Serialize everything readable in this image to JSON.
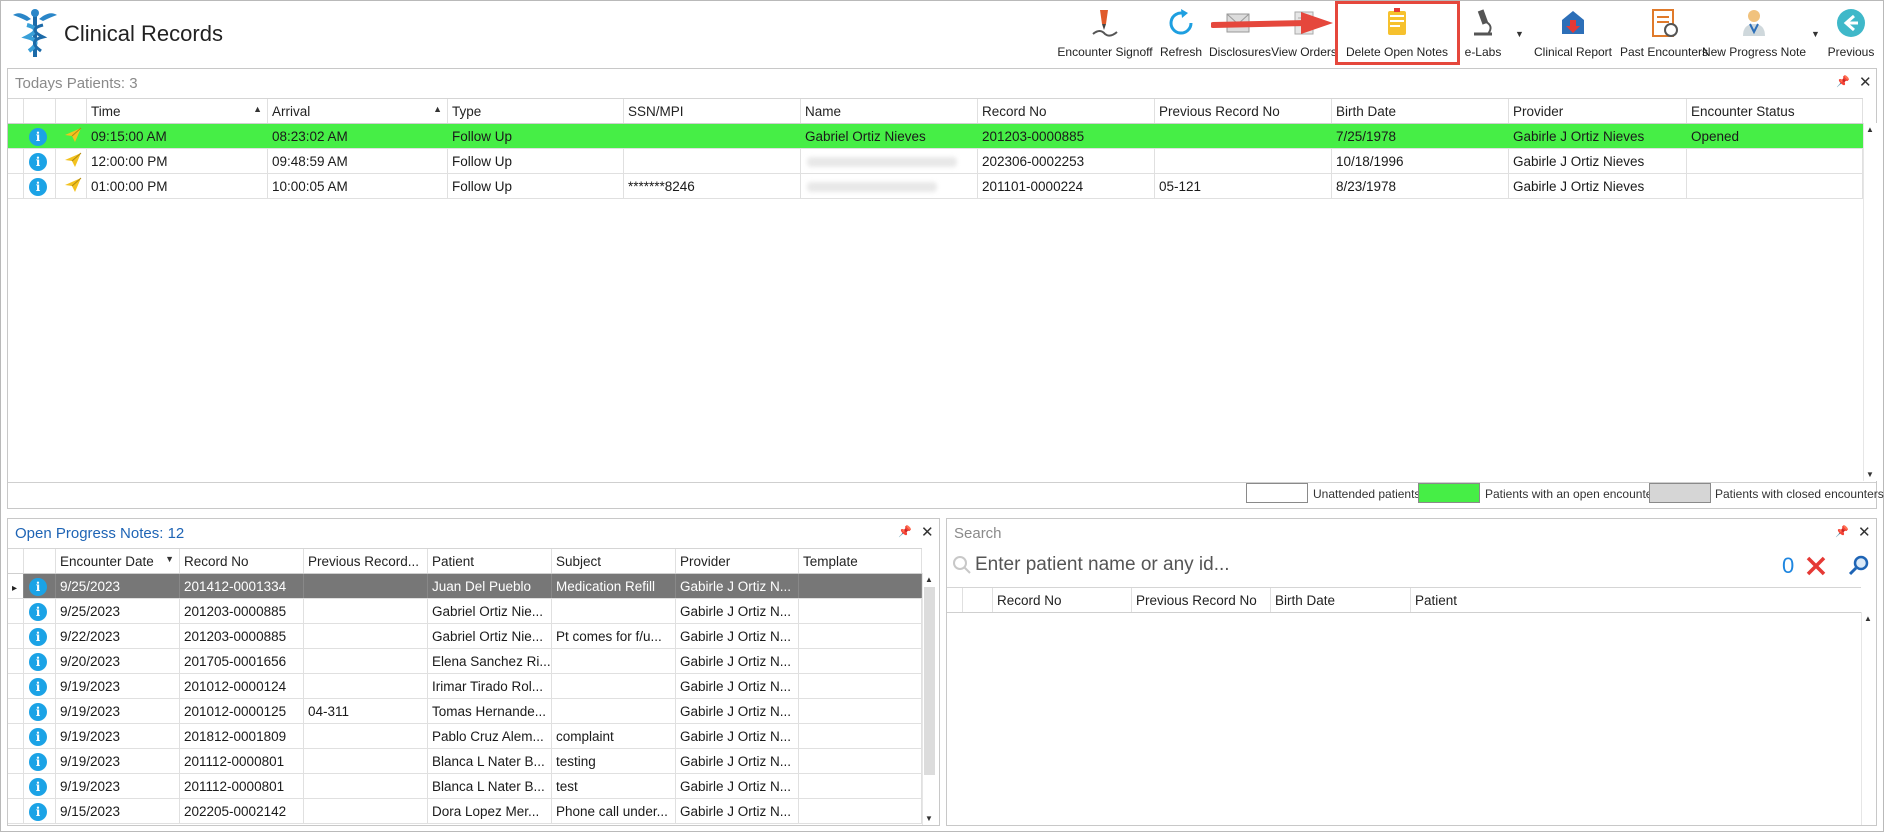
{
  "app": {
    "title": "Clinical Records"
  },
  "toolbar": [
    {
      "id": "encounter-signoff",
      "label": "Encounter Signoff"
    },
    {
      "id": "refresh",
      "label": "Refresh"
    },
    {
      "id": "disclosures",
      "label": "Disclosures"
    },
    {
      "id": "view-orders",
      "label": "View Orders"
    },
    {
      "id": "delete-open-notes",
      "label": "Delete Open Notes"
    },
    {
      "id": "e-labs",
      "label": "e-Labs"
    },
    {
      "id": "clinical-report",
      "label": "Clinical Report"
    },
    {
      "id": "past-encounters",
      "label": "Past Encounters"
    },
    {
      "id": "new-progress-note",
      "label": "New Progress Note"
    },
    {
      "id": "previous",
      "label": "Previous"
    }
  ],
  "todays": {
    "title": "Todays Patients:",
    "count": "3",
    "columns": [
      "Time",
      "Arrival",
      "Type",
      "SSN/MPI",
      "Name",
      "Record No",
      "Previous Record No",
      "Birth Date",
      "Provider",
      "Encounter Status"
    ],
    "rows": [
      {
        "time": "09:15:00 AM",
        "arrival": "08:23:02 AM",
        "type": "Follow Up",
        "ssn": "",
        "name": "Gabriel Ortiz Nieves",
        "record": "201203-0000885",
        "prev": "",
        "birth": "7/25/1978",
        "provider": "Gabirle J Ortiz Nieves",
        "status": "Opened"
      },
      {
        "time": "12:00:00 PM",
        "arrival": "09:48:59 AM",
        "type": "Follow Up",
        "ssn": "",
        "name": "",
        "record": "202306-0002253",
        "prev": "",
        "birth": "10/18/1996",
        "provider": "Gabirle J Ortiz Nieves",
        "status": ""
      },
      {
        "time": "01:00:00 PM",
        "arrival": "10:00:05 AM",
        "type": "Follow Up",
        "ssn": "*******8246",
        "name": "",
        "record": "201101-0000224",
        "prev": "05-121",
        "birth": "8/23/1978",
        "provider": "Gabirle J Ortiz Nieves",
        "status": ""
      }
    ],
    "legend": {
      "unattended": "Unattended patients",
      "open": "Patients with an open encounter",
      "closed": "Patients with closed encounters"
    }
  },
  "notes": {
    "title": "Open Progress Notes:",
    "count": "12",
    "columns": [
      "Encounter Date",
      "Record No",
      "Previous Record...",
      "Patient",
      "Subject",
      "Provider",
      "Template"
    ],
    "rows": [
      {
        "date": "9/25/2023",
        "record": "201412-0001334",
        "prev": "",
        "patient": "Juan Del Pueblo",
        "subject": "Medication Refill",
        "provider": "Gabirle J Ortiz N...",
        "template": ""
      },
      {
        "date": "9/25/2023",
        "record": "201203-0000885",
        "prev": "",
        "patient": "Gabriel Ortiz Nie...",
        "subject": "",
        "provider": "Gabirle J Ortiz N...",
        "template": ""
      },
      {
        "date": "9/22/2023",
        "record": "201203-0000885",
        "prev": "",
        "patient": "Gabriel Ortiz Nie...",
        "subject": "Pt comes for f/u...",
        "provider": "Gabirle J Ortiz N...",
        "template": ""
      },
      {
        "date": "9/20/2023",
        "record": "201705-0001656",
        "prev": "",
        "patient": "Elena Sanchez Ri...",
        "subject": "",
        "provider": "Gabirle J Ortiz N...",
        "template": ""
      },
      {
        "date": "9/19/2023",
        "record": "201012-0000124",
        "prev": "",
        "patient": "Irimar Tirado Rol...",
        "subject": "",
        "provider": "Gabirle J Ortiz N...",
        "template": ""
      },
      {
        "date": "9/19/2023",
        "record": "201012-0000125",
        "prev": "04-311",
        "patient": "Tomas Hernande...",
        "subject": "",
        "provider": "Gabirle J Ortiz N...",
        "template": ""
      },
      {
        "date": "9/19/2023",
        "record": "201812-0001809",
        "prev": "",
        "patient": "Pablo Cruz Alem...",
        "subject": "complaint",
        "provider": "Gabirle J Ortiz N...",
        "template": ""
      },
      {
        "date": "9/19/2023",
        "record": "201112-0000801",
        "prev": "",
        "patient": "Blanca L Nater B...",
        "subject": "testing",
        "provider": "Gabirle J Ortiz N...",
        "template": ""
      },
      {
        "date": "9/19/2023",
        "record": "201112-0000801",
        "prev": "",
        "patient": "Blanca L Nater B...",
        "subject": "test",
        "provider": "Gabirle J Ortiz N...",
        "template": ""
      },
      {
        "date": "9/15/2023",
        "record": "202205-0002142",
        "prev": "",
        "patient": "Dora Lopez Mer...",
        "subject": "Phone call under...",
        "provider": "Gabirle J Ortiz N...",
        "template": ""
      }
    ]
  },
  "search": {
    "title": "Search",
    "placeholder": "Enter patient name or any id...",
    "count": "0",
    "columns": [
      "Record No",
      "Previous Record No",
      "Birth Date",
      "Patient"
    ]
  },
  "colors": {
    "open_encounter": "#46ee46",
    "closed_encounter": "#d6d6d6",
    "accent": "#1e64b5",
    "highlight": "#e5473c"
  }
}
